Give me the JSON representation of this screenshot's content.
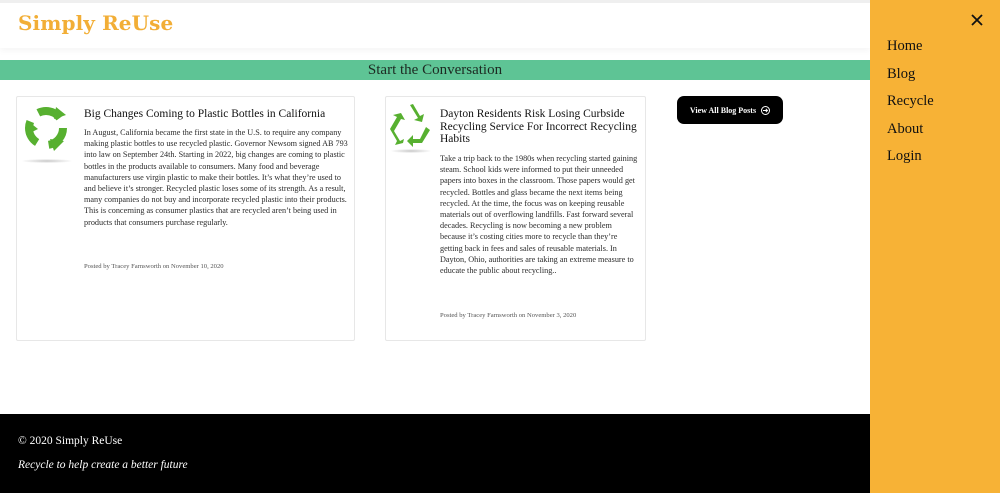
{
  "header": {
    "brand": "Simply ReUse"
  },
  "banner": {
    "title": "Start the Conversation"
  },
  "posts": [
    {
      "title": "Big Changes Coming to Plastic Bottles in California",
      "excerpt": "In August, California became the first state in the U.S. to require any company making plastic bottles to use recycled plastic. Governor Newsom signed AB 793 into law on September 24th. Starting in 2022, big changes are coming to plastic bottles in the products available to consumers. Many food and beverage manufacturers use virgin plastic to make their bottles. It’s what they’re used to and believe it’s stronger. Recycled plastic loses some of its strength. As a result, many companies do not buy and incorporate recycled plastic into their products. This is concerning as consumer plastics that are recycled aren’t being used in products that consumers purchase regularly.",
      "meta": "Posted by Tracey Farnsworth on November 10, 2020",
      "icon": "recycle-arrows-circle-icon"
    },
    {
      "title": "Dayton Residents Risk Losing Curbside Recycling Service For Incorrect Recycling Habits",
      "excerpt": "Take a trip back to the 1980s when recycling started gaining steam. School kids were informed to put their unneeded papers into boxes in the classroom. Those papers would get recycled. Bottles and glass became the next items being recycled. At the time, the focus was on keeping reusable materials out of overflowing landfills. Fast forward several decades. Recycling is now becoming a new problem because it’s costing cities more to recycle than they’re getting back in fees and sales of reusable materials. In Dayton, Ohio, authorities are taking an extreme measure to educate the public about recycling..",
      "meta": "Posted by Tracey Farnsworth on November 3, 2020",
      "icon": "recycle-triangle-icon"
    }
  ],
  "actions": {
    "view_all_label": "View All Blog Posts",
    "view_all_icon": "arrow-right-circle-icon"
  },
  "footer": {
    "copyright": "© 2020 Simply ReUse",
    "tagline": "Recycle to help create a better future"
  },
  "sidenav": {
    "close_icon": "close-icon",
    "items": [
      {
        "label": "Home"
      },
      {
        "label": "Blog"
      },
      {
        "label": "Recycle"
      },
      {
        "label": "About"
      },
      {
        "label": "Login"
      }
    ]
  },
  "colors": {
    "brand": "#f2ae36",
    "banner": "#5ec495",
    "sidenav": "#f7b236",
    "footer": "#000000",
    "icon_green": "#57b030"
  }
}
